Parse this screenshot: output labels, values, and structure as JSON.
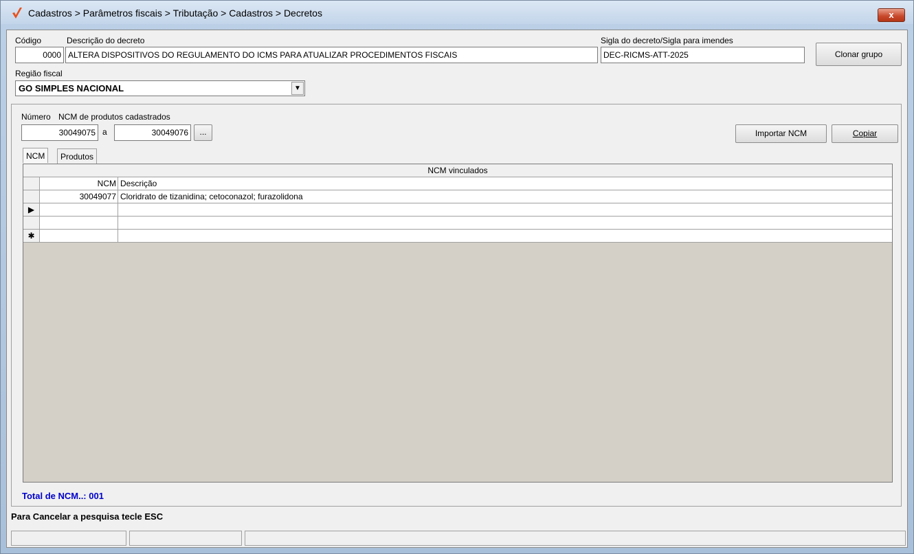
{
  "window": {
    "title": "Cadastros > Parâmetros fiscais > Tributação > Cadastros > Decretos",
    "close_label": "x",
    "app_icon": "checkmark-icon"
  },
  "form": {
    "codigo_label": "Código",
    "codigo_value": "0000",
    "descricao_label": "Descrição do decreto",
    "descricao_value": "ALTERA DISPOSITIVOS DO REGULAMENTO DO ICMS PARA ATUALIZAR PROCEDIMENTOS FISCAIS",
    "sigla_label": "Sigla do decreto/Sigla para imendes",
    "sigla_value": "DEC-RICMS-ATT-2025",
    "clonar_label": "Clonar grupo",
    "regiao_label": "Região fiscal",
    "regiao_value": "GO SIMPLES NACIONAL"
  },
  "ncm_filter": {
    "numero_label": "Número",
    "ncm_label": "NCM de produtos cadastrados",
    "from_value": "30049075",
    "sep_label": "a",
    "to_value": "30049076",
    "browse_label": "...",
    "importar_label": "Importar NCM",
    "copiar_label": "Copiar"
  },
  "tabs": [
    {
      "label": "NCM"
    },
    {
      "label": "Produtos"
    }
  ],
  "grid": {
    "title": "NCM vinculados",
    "col_ncm": "NCM",
    "col_desc": "Descrição",
    "rows": [
      {
        "ncm": "30049077",
        "descricao": "Cloridrato de tizanidina; cetoconazol; furazolidona",
        "indicator": ""
      },
      {
        "ncm": "",
        "descricao": "",
        "indicator": "▶"
      },
      {
        "ncm": "",
        "descricao": "",
        "indicator": ""
      },
      {
        "ncm": "",
        "descricao": "",
        "indicator": "✱"
      }
    ]
  },
  "total": "Total de NCM..: 001",
  "hint": "Para Cancelar a pesquisa tecle ESC"
}
